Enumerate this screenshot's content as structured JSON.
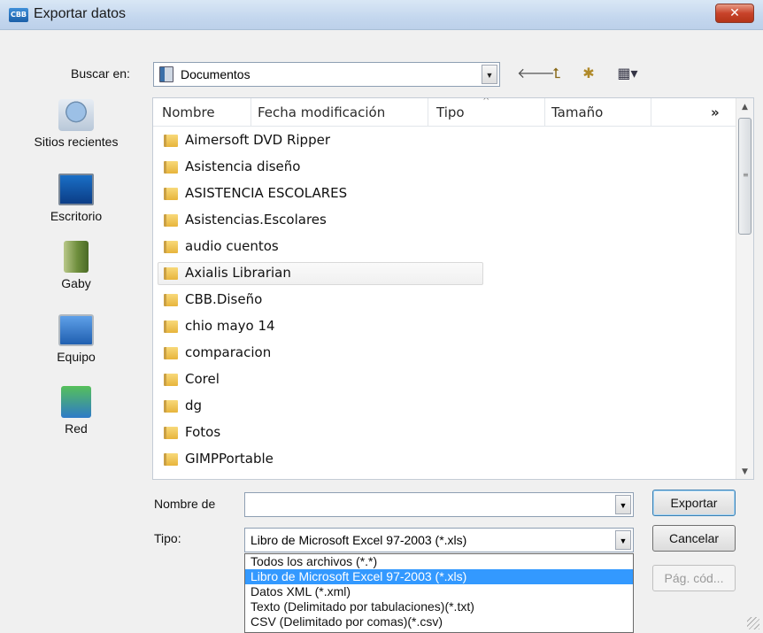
{
  "window": {
    "icon_text": "CBB",
    "title": "Exportar datos",
    "close_glyph": "✕"
  },
  "toolbar": {
    "look_in_label": "Buscar en:",
    "location": "Documentos",
    "back_glyph": "🡐",
    "up_glyph": "⮤",
    "new_folder_glyph": "✱",
    "views_glyph": "▦▾"
  },
  "places": [
    {
      "label": "Sitios recientes",
      "icon": "recent-places-icon"
    },
    {
      "label": "Escritorio",
      "icon": "desktop-icon"
    },
    {
      "label": "Gaby",
      "icon": "user-folder-icon"
    },
    {
      "label": "Equipo",
      "icon": "computer-icon"
    },
    {
      "label": "Red",
      "icon": "network-icon"
    }
  ],
  "file_list": {
    "columns": [
      "Nombre",
      "Fecha modificación",
      "Tipo",
      "Tamaño"
    ],
    "more_columns_glyph": "»",
    "items": [
      "Aimersoft DVD Ripper",
      "Asistencia diseño",
      "ASISTENCIA ESCOLARES",
      "Asistencias.Escolares",
      "audio cuentos",
      "Axialis Librarian",
      "CBB.Diseño",
      "chio mayo 14",
      "comparacion",
      "Corel",
      "dg",
      "Fotos",
      "GIMPPortable"
    ],
    "hovered_index": 5
  },
  "form": {
    "filename_label": "Nombre de",
    "filename_value": "",
    "type_label": "Tipo:",
    "type_value": "Libro de Microsoft Excel 97-2003 (*.xls)",
    "export_button": "Exportar",
    "cancel_button": "Cancelar",
    "codepage_button": "Pág. cód..."
  },
  "type_dropdown": {
    "options": [
      "Todos los archivos (*.*)",
      "Libro de Microsoft Excel 97-2003 (*.xls)",
      "Datos XML (*.xml)",
      "Texto (Delimitado por tabulaciones)(*.txt)",
      "CSV (Delimitado por comas)(*.csv)"
    ],
    "selected_index": 1
  },
  "colors": {
    "selection": "#3399ff",
    "close_button": "#c8432a",
    "folder": "#e7b43c"
  }
}
